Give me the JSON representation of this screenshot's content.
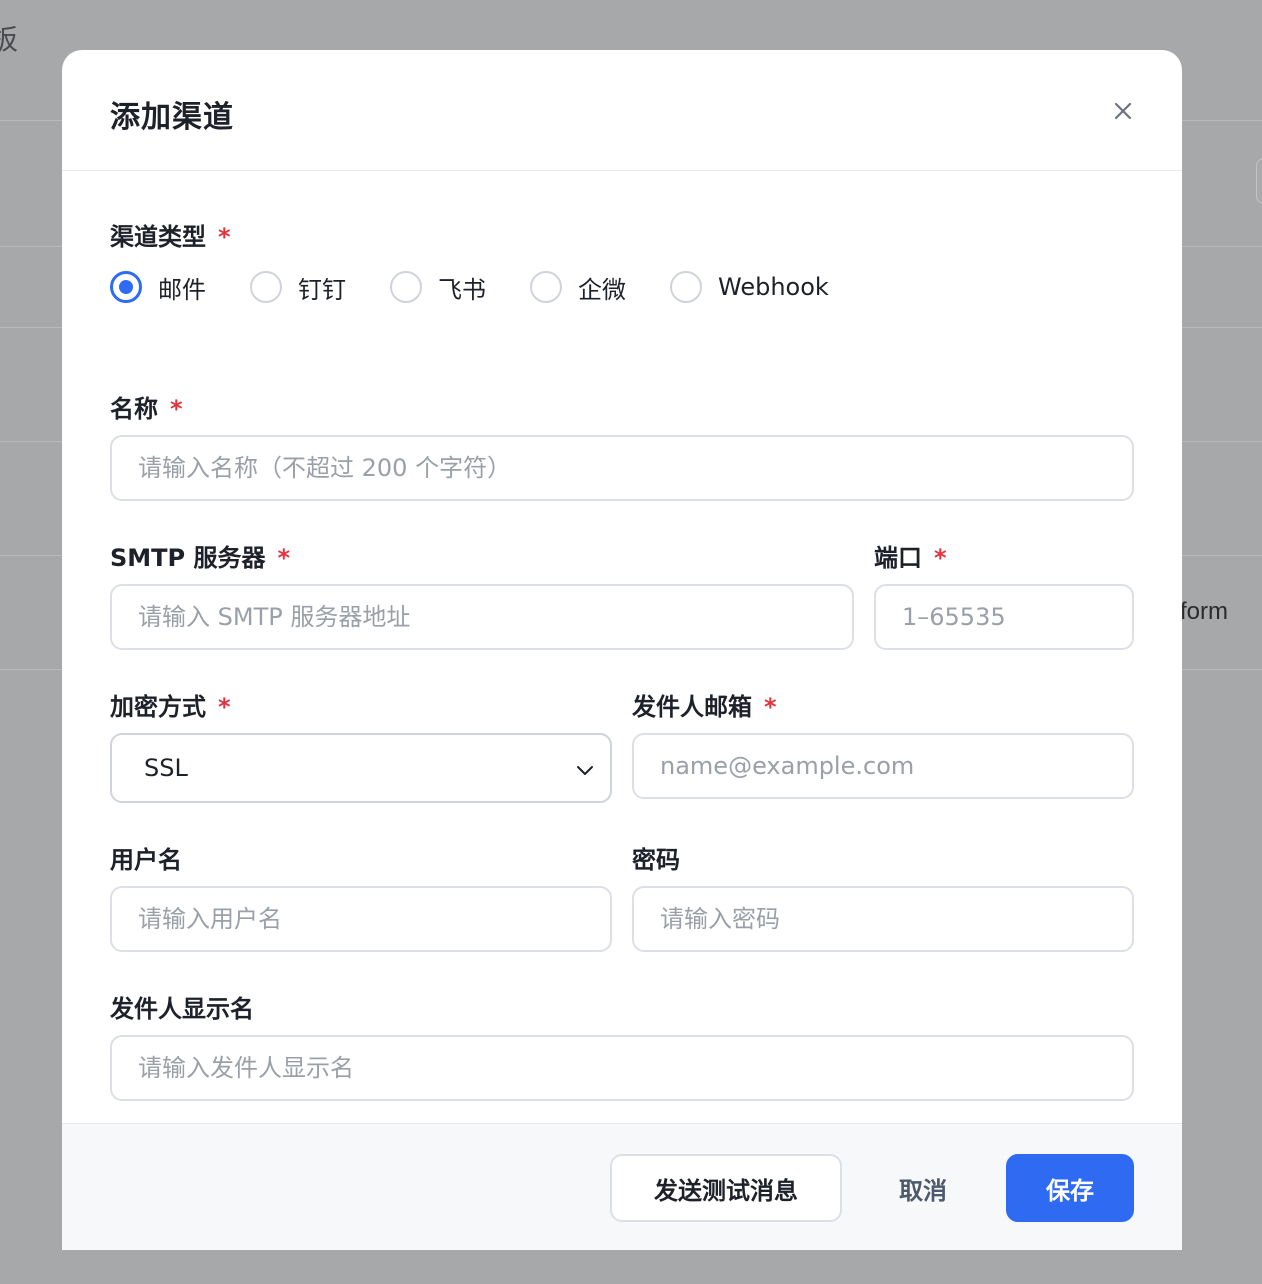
{
  "background": {
    "corner_text": "板",
    "edge_text": "form"
  },
  "modal": {
    "title": "添加渠道",
    "close_icon": "close-icon"
  },
  "form": {
    "channel_type": {
      "label": "渠道类型",
      "required_mark": "*",
      "options": [
        "邮件",
        "钉钉",
        "飞书",
        "企微",
        "Webhook"
      ],
      "selected": "邮件"
    },
    "name": {
      "label": "名称",
      "required_mark": "*",
      "placeholder": "请输入名称（不超过 200 个字符）"
    },
    "smtp_server": {
      "label": "SMTP 服务器",
      "required_mark": "*",
      "placeholder": "请输入 SMTP 服务器地址"
    },
    "port": {
      "label": "端口",
      "required_mark": "*",
      "placeholder": "1–65535"
    },
    "encryption": {
      "label": "加密方式",
      "required_mark": "*",
      "value": "SSL"
    },
    "sender_email": {
      "label": "发件人邮箱",
      "required_mark": "*",
      "placeholder": "name@example.com"
    },
    "username": {
      "label": "用户名",
      "placeholder": "请输入用户名"
    },
    "password": {
      "label": "密码",
      "placeholder": "请输入密码"
    },
    "sender_display_name": {
      "label": "发件人显示名",
      "placeholder": "请输入发件人显示名"
    }
  },
  "footer": {
    "test_label": "发送测试消息",
    "cancel_label": "取消",
    "save_label": "保存"
  },
  "colors": {
    "primary": "#2f6bf2",
    "required": "#e5323d",
    "overlay": "#a7a8aa"
  }
}
